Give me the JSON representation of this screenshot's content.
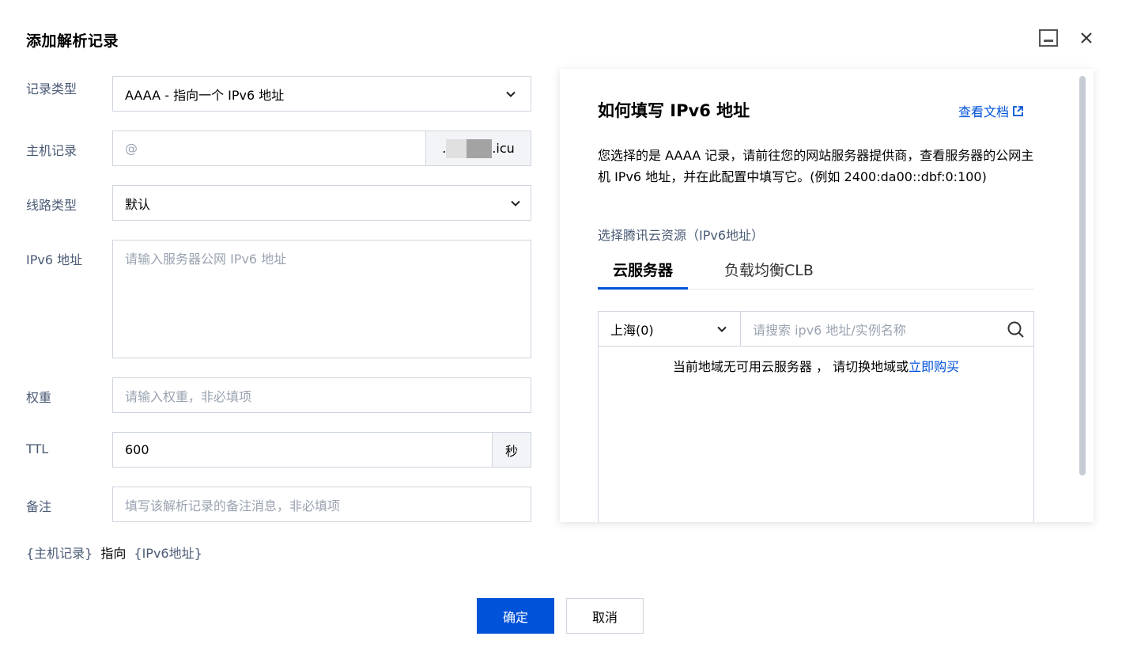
{
  "dialog": {
    "title": "添加解析记录"
  },
  "form": {
    "record_type": {
      "label": "记录类型",
      "value": "AAAA - 指向一个 IPv6 地址"
    },
    "host": {
      "label": "主机记录",
      "placeholder": "@",
      "suffix_prefix": ".",
      "suffix_end": ".icu"
    },
    "line_type": {
      "label": "线路类型",
      "value": "默认"
    },
    "ipv6": {
      "label": "IPv6 地址",
      "placeholder": "请输入服务器公网 IPv6 地址"
    },
    "weight": {
      "label": "权重",
      "placeholder": "请输入权重，非必填项"
    },
    "ttl": {
      "label": "TTL",
      "value": "600",
      "unit": "秒"
    },
    "remark": {
      "label": "备注",
      "placeholder": "填写该解析记录的备注消息，非必填项"
    }
  },
  "summary": {
    "host": "{主机记录}",
    "verb": "指向",
    "target": "{IPv6地址}"
  },
  "buttons": {
    "confirm": "确定",
    "cancel": "取消"
  },
  "help": {
    "title": "如何填写 IPv6 地址",
    "doc_link": "查看文档",
    "description": "您选择的是 AAAA 记录，请前往您的网站服务器提供商，查看服务器的公网主机 IPv6 地址，并在此配置中填写它。(例如 2400:da00::dbf:0:100)",
    "resource_label": "选择腾讯云资源（IPv6地址）",
    "tabs": [
      {
        "label": "云服务器",
        "active": true
      },
      {
        "label": "负载均衡CLB",
        "active": false
      }
    ],
    "region": "上海(0)",
    "search_placeholder": "请搜索 ipv6 地址/实例名称",
    "empty_text": "当前地域无可用云服务器 ，  请切换地域或",
    "buy_link": "立即购买"
  },
  "colors": {
    "primary": "#0052d9",
    "label": "#4b5b76",
    "border": "#cfd5de",
    "placeholder": "#9aa3b1"
  }
}
